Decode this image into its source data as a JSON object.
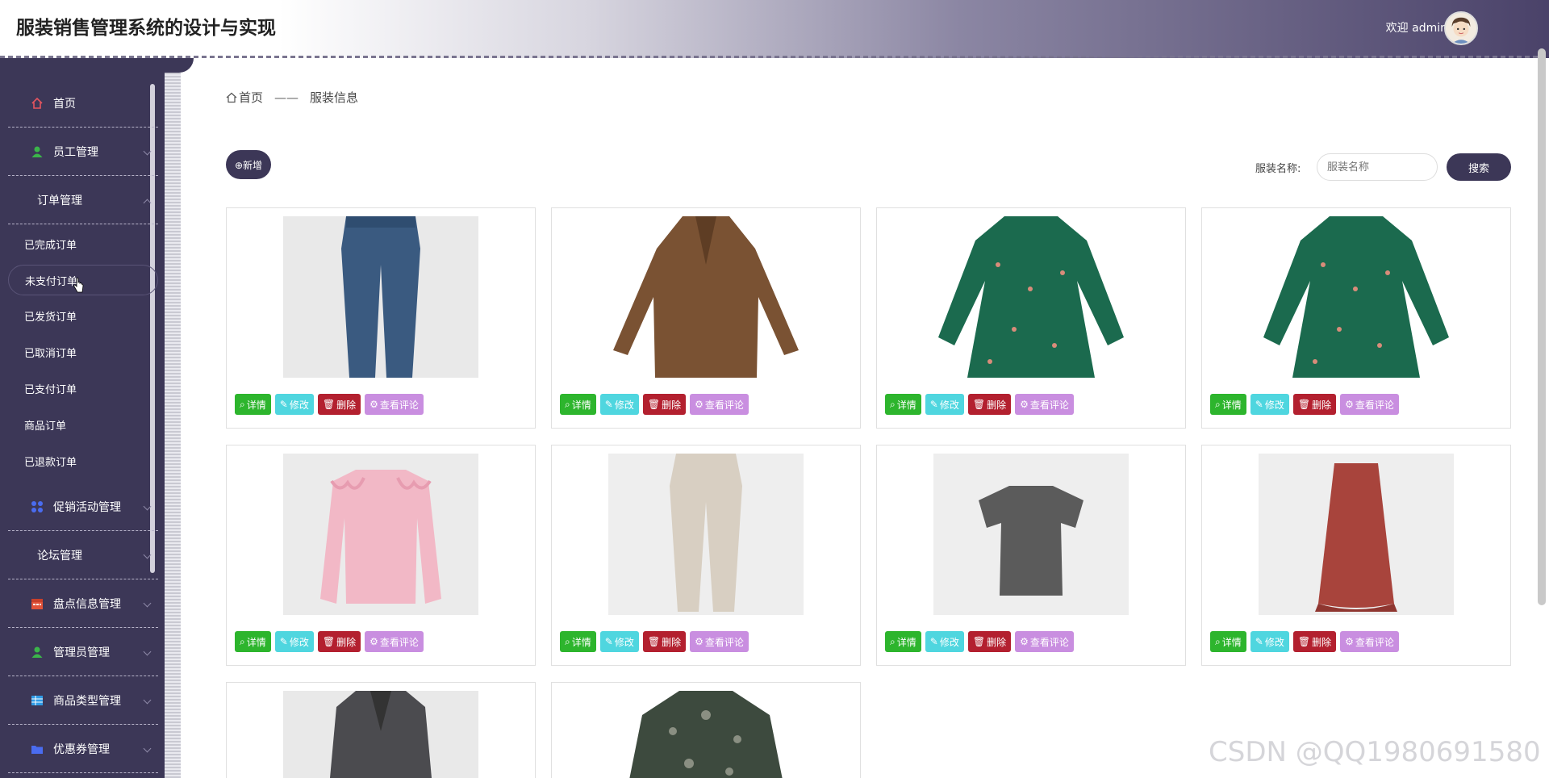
{
  "app": {
    "title": "服装销售管理系统的设计与实现",
    "welcome": "欢迎 admin"
  },
  "colors": {
    "sidebar": "#3c3757",
    "primary_button": "#3c3757",
    "detail": "#2db52d",
    "edit": "#4fd6df",
    "delete": "#b3202f",
    "comment": "#c98ee0"
  },
  "sidebar": {
    "items": [
      {
        "label": "首页",
        "icon": "home-icon",
        "expandable": false
      },
      {
        "label": "员工管理",
        "icon": "user-icon",
        "expandable": true
      },
      {
        "label": "订单管理",
        "icon": "",
        "expandable": true,
        "expanded": true,
        "children": [
          "已完成订单",
          "未支付订单",
          "已发货订单",
          "已取消订单",
          "已支付订单",
          "商品订单",
          "已退款订单"
        ],
        "active_child": "未支付订单"
      },
      {
        "label": "促销活动管理",
        "icon": "apps-icon",
        "expandable": true
      },
      {
        "label": "论坛管理",
        "icon": "",
        "expandable": true
      },
      {
        "label": "盘点信息管理",
        "icon": "calendar-icon",
        "expandable": true
      },
      {
        "label": "管理员管理",
        "icon": "user-icon",
        "expandable": true
      },
      {
        "label": "商品类型管理",
        "icon": "table-icon",
        "expandable": true
      },
      {
        "label": "优惠券管理",
        "icon": "folder-icon",
        "expandable": true
      }
    ]
  },
  "breadcrumb": {
    "home": "首页",
    "separator": "——",
    "current": "服装信息"
  },
  "toolbar": {
    "add_label": "⊕新增",
    "search_label": "服装名称:",
    "search_placeholder": "服装名称",
    "search_button": "搜索"
  },
  "card_actions": {
    "detail": "详情",
    "edit": "修改",
    "delete": "删除",
    "comment": "查看评论"
  },
  "products": [
    {
      "item": "jeans"
    },
    {
      "item": "brown-coat"
    },
    {
      "item": "green-floral-dress"
    },
    {
      "item": "green-floral-dress"
    },
    {
      "item": "pink-sweatshirt"
    },
    {
      "item": "beige-pants"
    },
    {
      "item": "grey-tshirt"
    },
    {
      "item": "red-skirt"
    },
    {
      "item": "grey-blazer"
    },
    {
      "item": "patterned-blouse"
    }
  ],
  "watermark": "CSDN @QQ1980691580"
}
